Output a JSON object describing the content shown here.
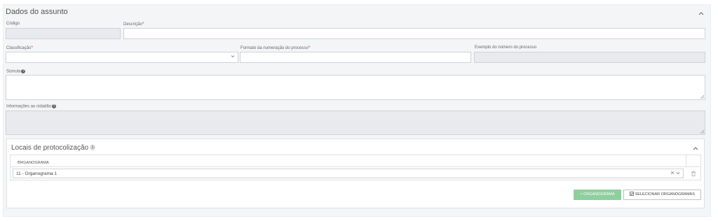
{
  "panel": {
    "title": "Dados do assunto"
  },
  "fields": {
    "codigo": {
      "label": "Código",
      "value": ""
    },
    "descricao": {
      "label": "Descrição",
      "required": "*",
      "value": ""
    },
    "classificacao": {
      "label": "Classificação",
      "required": "*",
      "value": ""
    },
    "formato": {
      "label": "Formato da numeração do processo",
      "required": "*",
      "value": ""
    },
    "exemplo": {
      "label": "Exemplo do número do processo",
      "value": ""
    },
    "sumula": {
      "label": "Súmula",
      "value": ""
    },
    "informacoes": {
      "label": "Informações ao cidadão",
      "value": ""
    }
  },
  "locais": {
    "title": "Locais de protocolização",
    "count": "1",
    "column_header": "ORGANOGRAMA",
    "required": "*",
    "rows": [
      {
        "value": "11 - Organograma 1"
      }
    ],
    "add_button": "+ ORGANOGRAMA",
    "select_button": "SELECIONAR ORGANOGRAMAS"
  },
  "icons": {
    "collapse": "chevron-up-icon",
    "help": "question-circle-icon",
    "dropdown": "chevron-down-icon",
    "clear": "close-icon",
    "delete": "trash-icon",
    "select": "checkbox-icon"
  },
  "colors": {
    "required": "#d9534f",
    "add_button_bg": "#8fcf9d",
    "disabled_bg": "#e9eaed",
    "panel_bg": "#f4f5f7"
  }
}
